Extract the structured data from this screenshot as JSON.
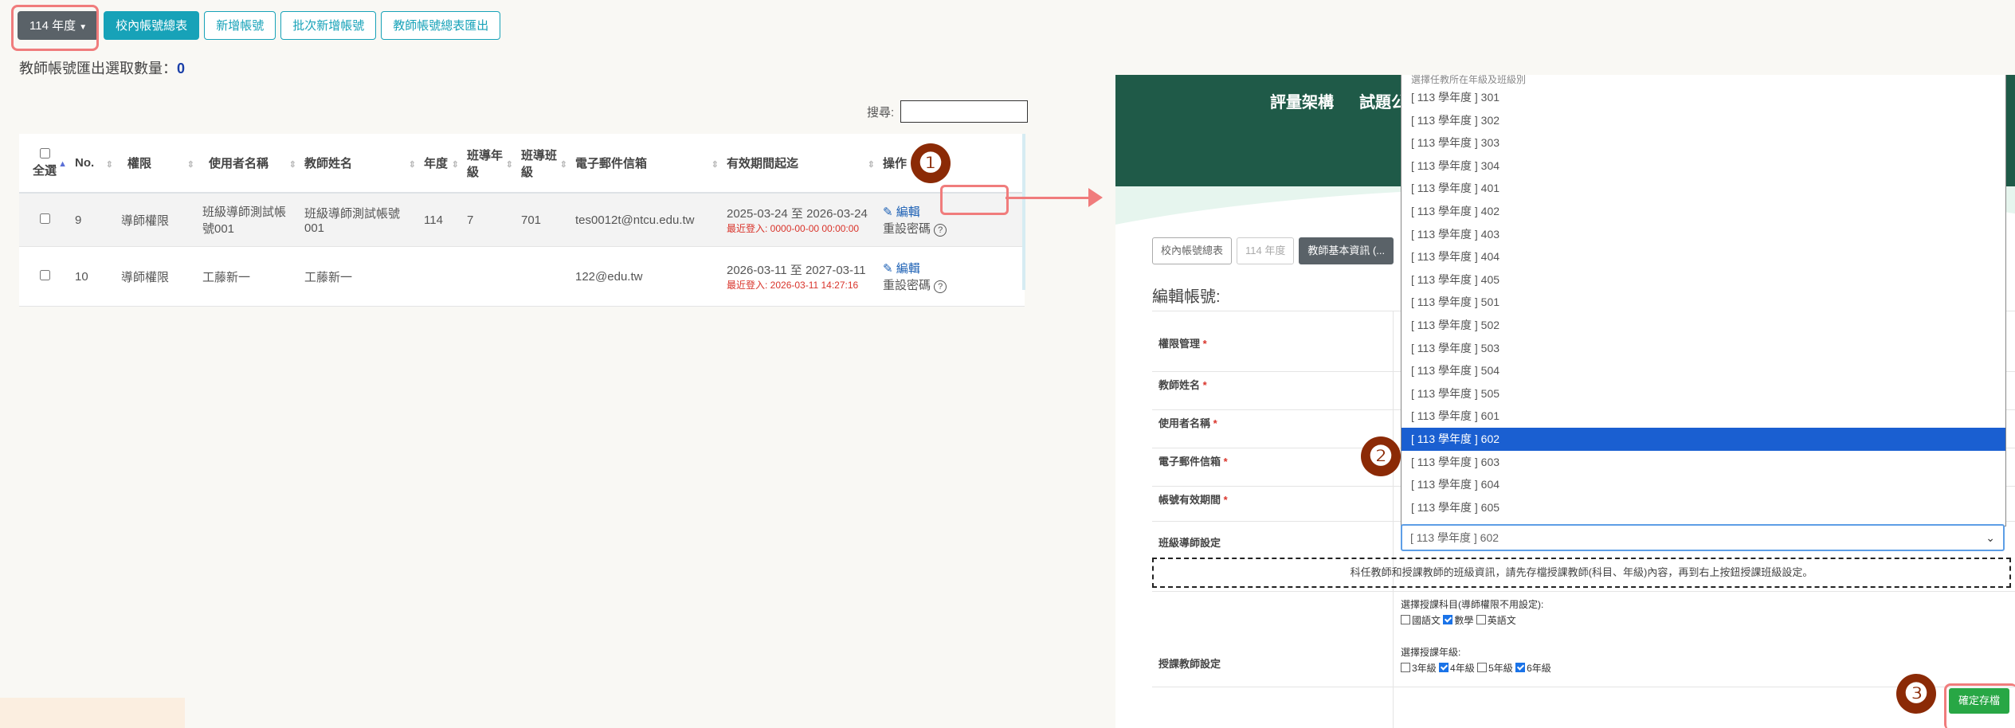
{
  "toolbar": {
    "year_dropdown": "114 年度",
    "buttons": [
      "校內帳號總表",
      "新增帳號",
      "批次新增帳號",
      "教師帳號總表匯出"
    ]
  },
  "export_count": {
    "label": "教師帳號匯出選取數量：",
    "value": "0"
  },
  "search_label": "搜尋:",
  "table": {
    "headers": [
      "全選",
      "No.",
      "權限",
      "使用者名稱",
      "教師姓名",
      "年度",
      "班導年級",
      "班導班級",
      "電子郵件信箱",
      "有效期間起迄",
      "操作"
    ],
    "rows": [
      {
        "no": "9",
        "role": "導師權限",
        "username": "班級導師測試帳號001",
        "name": "班級導師測試帳號001",
        "year": "114",
        "grade": "7",
        "class": "701",
        "email": "tes0012t@ntcu.edu.tw",
        "period": "2025-03-24 至 2026-03-24",
        "last_login": "最近登入: 0000-00-00 00:00:00",
        "edit": "編輯",
        "reset": "重設密碼"
      },
      {
        "no": "10",
        "role": "導師權限",
        "username": "工藤新一",
        "name": "工藤新一",
        "year": "",
        "grade": "",
        "class": "",
        "email": "122@edu.tw",
        "period": "2026-03-11 至 2027-03-11",
        "last_login": "最近登入: 2026-03-11 14:27:16",
        "edit": "編輯",
        "reset": "重設密碼"
      }
    ]
  },
  "markers": [
    "❶",
    "❷",
    "❸"
  ],
  "right": {
    "nav": [
      "評量架構",
      "試題公"
    ],
    "buttons": [
      "校內帳號總表",
      "114 年度",
      "教師基本資訊 (..."
    ],
    "edit_title": "編輯帳號:",
    "labels": {
      "role": "權限管理",
      "teacher_name": "教師姓名",
      "username": "使用者名稱",
      "email": "電子郵件信箱",
      "period": "帳號有效期間",
      "homeroom": "班級導師設定",
      "subject_teacher": "授課教師設定"
    },
    "required_mark": "*",
    "dropdown": {
      "header": "選擇任教所在年級及班級別",
      "options": [
        "[ 113 學年度 ] 301",
        "[ 113 學年度 ] 302",
        "[ 113 學年度 ] 303",
        "[ 113 學年度 ] 304",
        "[ 113 學年度 ] 401",
        "[ 113 學年度 ] 402",
        "[ 113 學年度 ] 403",
        "[ 113 學年度 ] 404",
        "[ 113 學年度 ] 405",
        "[ 113 學年度 ] 501",
        "[ 113 學年度 ] 502",
        "[ 113 學年度 ] 503",
        "[ 113 學年度 ] 504",
        "[ 113 學年度 ] 505",
        "[ 113 學年度 ] 601",
        "[ 113 學年度 ] 602",
        "[ 113 學年度 ] 603",
        "[ 113 學年度 ] 604",
        "[ 113 學年度 ] 605"
      ],
      "selected": "[ 113 學年度 ] 602"
    },
    "notice": "科任教師和授課教師的班級資訊，請先存檔授課教師(科目、年級)內容，再到右上按鈕授課班級設定。",
    "subject_prompt": "選擇授課科目(導師權限不用設定):",
    "subjects": [
      {
        "label": "國語文",
        "checked": false
      },
      {
        "label": "數學",
        "checked": true
      },
      {
        "label": "英語文",
        "checked": false
      }
    ],
    "grade_prompt": "選擇授課年級:",
    "grades": [
      {
        "label": "3年級",
        "checked": false
      },
      {
        "label": "4年級",
        "checked": true
      },
      {
        "label": "5年級",
        "checked": false
      },
      {
        "label": "6年級",
        "checked": true
      }
    ],
    "save": "確定存檔"
  },
  "colors": {
    "accent": "#17a2b8",
    "highlight": "#f07c7c",
    "header_green": "#1f5a48",
    "selected_blue": "#1a5fd1",
    "save_green": "#28a745"
  }
}
